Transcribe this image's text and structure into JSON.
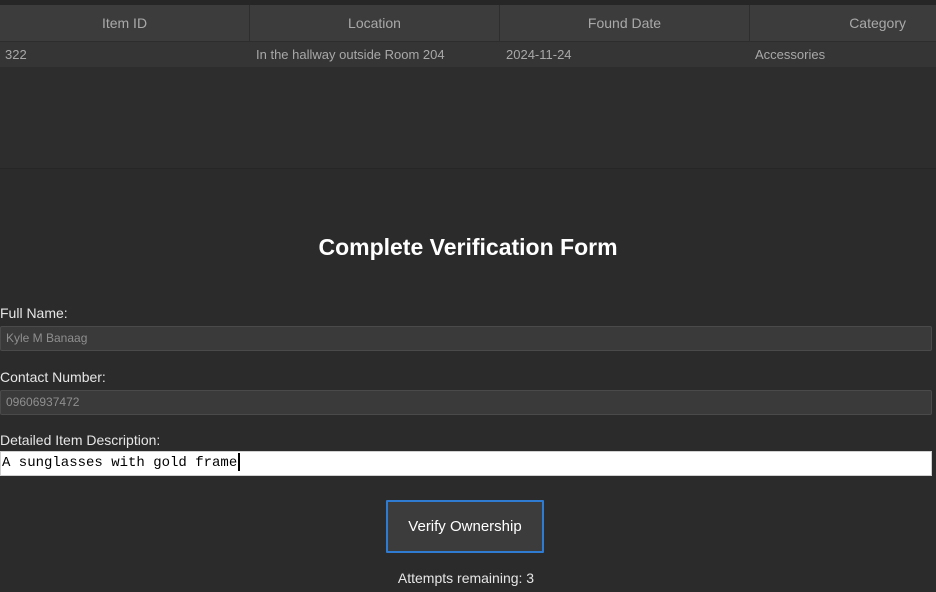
{
  "table": {
    "columns": [
      "Item ID",
      "Location",
      "Found Date",
      "Category"
    ],
    "rows": [
      [
        "322",
        "In the hallway outside Room 204",
        "2024-11-24",
        "Accessories"
      ]
    ]
  },
  "form": {
    "title": "Complete Verification Form",
    "full_name_label": "Full Name:",
    "full_name_value": "Kyle M Banaag",
    "contact_label": "Contact Number:",
    "contact_value": "09606937472",
    "description_label": "Detailed Item Description:",
    "description_value": "A sunglasses with gold frame",
    "verify_button": "Verify Ownership",
    "attempts_text": "Attempts remaining: 3"
  },
  "colors": {
    "background": "#2b2b2b",
    "header": "#3c3c3c",
    "button_border": "#2f7bd1"
  }
}
